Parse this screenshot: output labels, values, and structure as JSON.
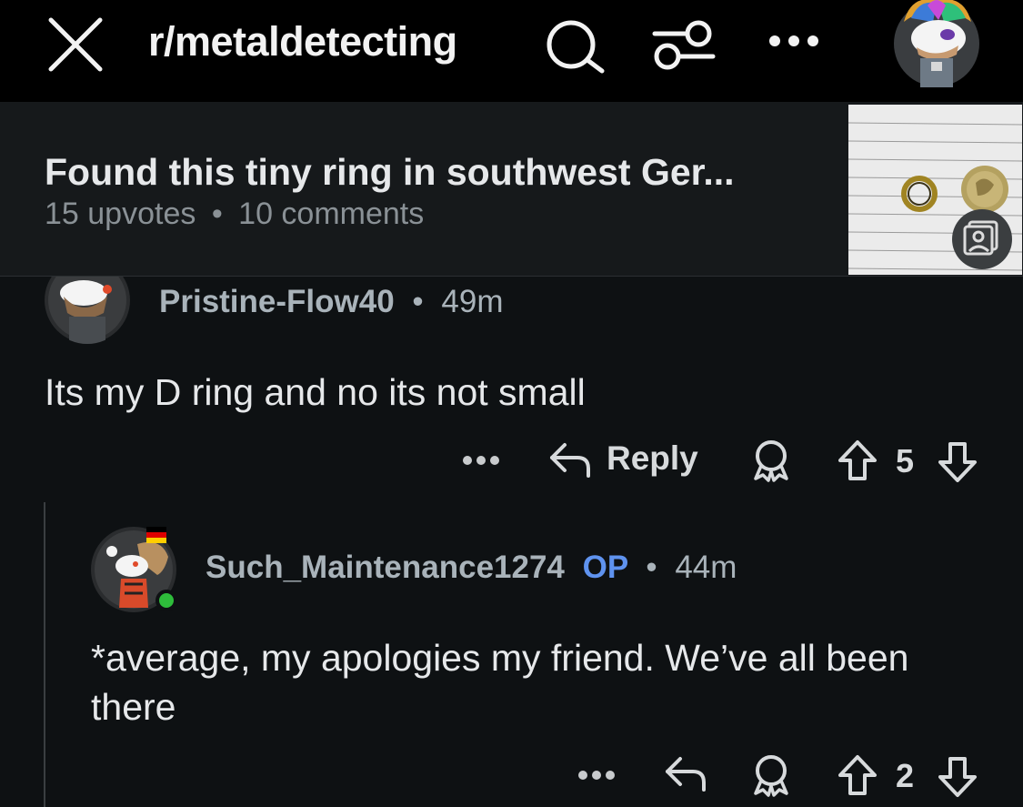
{
  "header": {
    "subreddit": "r/metaldetecting",
    "close_icon": "close-icon",
    "search_icon": "search-icon",
    "filter_icon": "filter-icon",
    "more_icon": "more-icon"
  },
  "post": {
    "title": "Found this tiny ring in southwest Ger...",
    "upvotes": "15 upvotes",
    "separator": "•",
    "comments": "10 comments"
  },
  "comments": [
    {
      "username": "Pristine-Flow40",
      "separator": "•",
      "time": "49m",
      "body": "Its my D ring and no its not small",
      "actions": {
        "more": "more-icon",
        "reply_label": "Reply",
        "award": "award-icon",
        "upvote": "upvote-icon",
        "score": "5",
        "downvote": "downvote-icon"
      }
    },
    {
      "username": "Such_Maintenance1274",
      "op_tag": "OP",
      "separator": "•",
      "time": "44m",
      "body": "*average, my apologies my friend. We’ve all been there",
      "online": true,
      "actions": {
        "more": "more-icon",
        "reply": "reply-icon",
        "award": "award-icon",
        "upvote": "upvote-icon",
        "score": "2",
        "downvote": "downvote-icon"
      }
    }
  ],
  "colors": {
    "background": "#0e1113",
    "header": "#000000",
    "post_bar": "#16191b",
    "op_blue": "#5f93ef",
    "online_green": "#2ebd3b"
  }
}
